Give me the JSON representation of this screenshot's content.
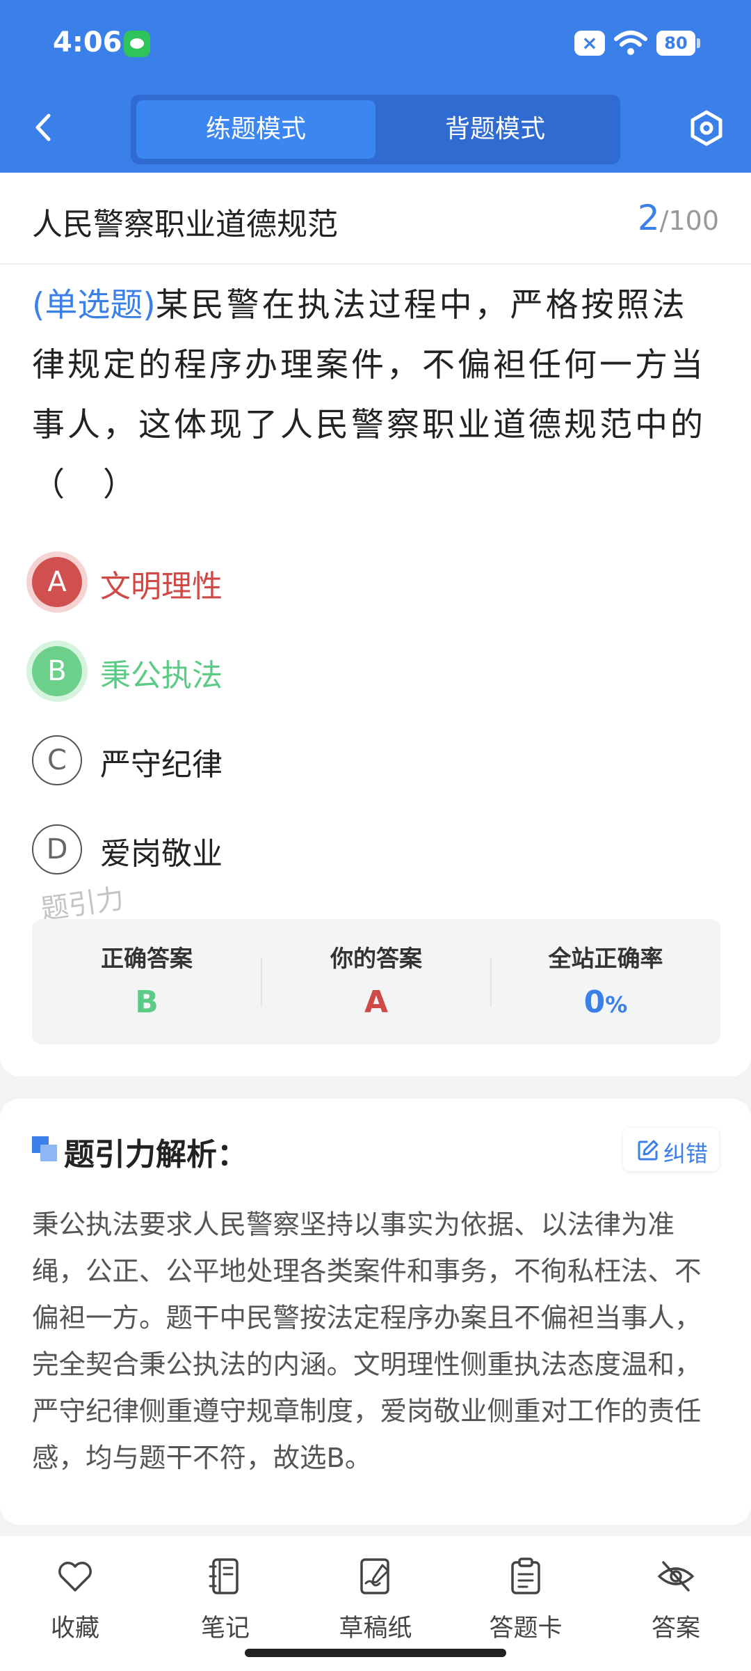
{
  "status": {
    "time": "4:06",
    "battery": "80"
  },
  "header": {
    "tabs": [
      {
        "label": "练题模式",
        "active": true
      },
      {
        "label": "背题模式",
        "active": false
      }
    ]
  },
  "quiz": {
    "title": "人民警察职业道德规范",
    "current": "2",
    "total": "/100",
    "question_type": "(单选题)",
    "question_text": "某民警在执法过程中，严格按照法律规定的程序办理案件，不偏袒任何一方当事人，这体现了人民警察职业道德规范中的（　）",
    "options": [
      {
        "letter": "A",
        "text": "文明理性",
        "state": "wrong"
      },
      {
        "letter": "B",
        "text": "秉公执法",
        "state": "correct"
      },
      {
        "letter": "C",
        "text": "严守纪律",
        "state": "normal"
      },
      {
        "letter": "D",
        "text": "爱岗敬业",
        "state": "normal"
      }
    ],
    "watermark": "题引力"
  },
  "stats": {
    "correct_label": "正确答案",
    "correct_value": "B",
    "yours_label": "你的答案",
    "yours_value": "A",
    "rate_label": "全站正确率",
    "rate_value": "0",
    "rate_unit": "%"
  },
  "analysis": {
    "title": "题引力解析：",
    "report_label": "纠错",
    "body": "秉公执法要求人民警察坚持以事实为依据、以法律为准绳，公正、公平地处理各类案件和事务，不徇私枉法、不偏袒一方。题干中民警按法定程序办案且不偏袒当事人，完全契合秉公执法的内涵。文明理性侧重执法态度温和，严守纪律侧重遵守规章制度，爱岗敬业侧重对工作的责任感，均与题干不符，故选B。"
  },
  "bottom_bar": {
    "items": [
      {
        "label": "收藏",
        "icon": "heart-icon"
      },
      {
        "label": "笔记",
        "icon": "notebook-icon"
      },
      {
        "label": "草稿纸",
        "icon": "draft-icon"
      },
      {
        "label": "答题卡",
        "icon": "clipboard-icon"
      },
      {
        "label": "答案",
        "icon": "eye-off-icon"
      }
    ]
  },
  "colors": {
    "primary": "#3b7fe8",
    "correct": "#5ccb85",
    "wrong": "#cf4a47"
  }
}
